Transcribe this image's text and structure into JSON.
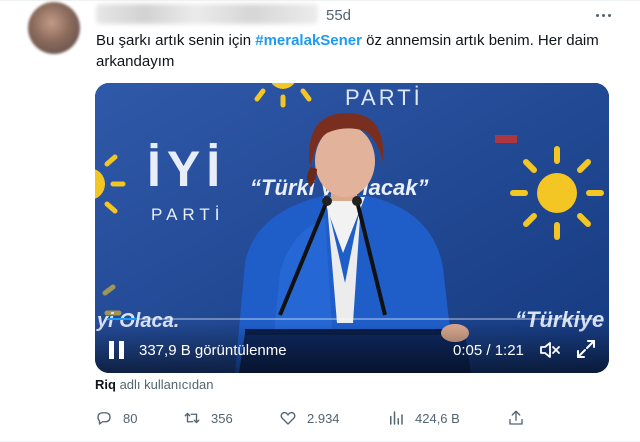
{
  "tweet": {
    "time": "55d",
    "text_before": "Bu şarkı artık senin için ",
    "hashtag": "#meralakSener",
    "text_after": " öz annemsin artık benim. Her daim arkandayım"
  },
  "video": {
    "brand_top": "PARTİ",
    "brand_logo": "İYİ",
    "brand_logo_sub": "PARTİ",
    "slogan": "“Türki  yi Olacak”",
    "slogan_bottom_left": "yi Olaca.",
    "slogan_bottom_right": "“Türkiye",
    "views_text": "337,9 B görüntülenme",
    "timecode": "0:05 / 1:21",
    "progress_fraction": 0.062
  },
  "attribution": {
    "user": "Riq",
    "suffix": " adlı kullanıcıdan"
  },
  "actions": {
    "replies": "80",
    "retweets": "356",
    "likes": "2.934",
    "views": "424,6 B"
  },
  "colors": {
    "accent": "#1d9bf0",
    "muted": "#536471",
    "sun": "#f3c623"
  }
}
